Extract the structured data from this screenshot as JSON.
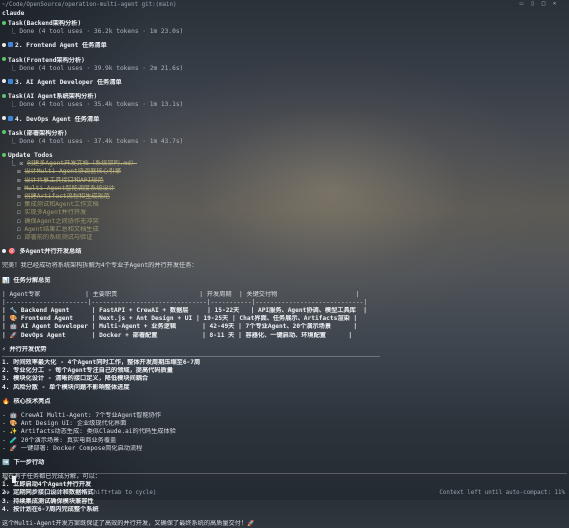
{
  "window": {
    "path": "~/Code/OpenSource/operation-multi-agent git:(main)",
    "app_title": "claude"
  },
  "tasks": [
    {
      "title": "Task(Backend架构分析)",
      "result": "Done (4 tool uses · 36.2k tokens · 1m 23.0s)"
    },
    {
      "heading": "2. Frontend Agent 任务清单"
    },
    {
      "title": "Task(Frontend架构分析)",
      "result": "Done (4 tool uses · 39.9k tokens · 2m 21.6s)"
    },
    {
      "heading": "3. AI Agent Developer 任务清单"
    },
    {
      "title": "Task(AI Agent系统架构分析)",
      "result": "Done (4 tool uses · 35.4k tokens · 1m 13.1s)"
    },
    {
      "heading": "4. DevOps Agent 任务清单"
    },
    {
      "title": "Task(部署架构分析)",
      "result": "Done (4 tool uses · 37.4k tokens · 1m 43.7s)"
    }
  ],
  "todos": {
    "title": "Update Todos",
    "items": [
      "创建多Agent开发文档（系统架构.md）",
      "设计Multi-Agent协调器核心引擎",
      "设计共享工具接口和API规范",
      "Multi-Agent智能调度系统设计",
      "创建Artifact流程和生成规范",
      "集成测试和Agent工作文档",
      "实现多Agent并行开发",
      "确保Agent之间协作无冲突",
      "Agent结果汇总和文档生成",
      "部署前的系统测试与验证"
    ]
  },
  "summary": {
    "heading": "多Agent并行开发总结",
    "intro": "完美！我已经成功将系统架构拆解为4个专业子Agent的并行开发任务：",
    "table_heading": "任务分解总览",
    "table_header": "| Agent专家            | 主要职责                      | 开发周期  | 关键交付物                     |",
    "table_sep": "|----------------------|-------------------------------|-----------|-----------------------------|",
    "rows": [
      "| 🔧 Backend Agent      | FastAPI + CrewAI + 数据层     | 15-22天   | API服务、Agent协调、模型工具库  |",
      "| 🎨 Frontend Agent     | Next.js + Ant Design + UI | 19-25天 | Chat界面、任务展示、Artifacts渲染 |",
      "| 🤖 AI Agent Developer | Multi-Agent + 业务逻辑       | 42-49天 | 7个专业Agent、20个演示场景      |",
      "| 🚀 DevOps Agent       | Docker + 部署配置            | 8-11 天 | 容器化、一键启动、环境配置      |"
    ],
    "adv_heading": "并行开发优势",
    "advantages": [
      "1. 时间效率最大化 - 4个Agent同时工作，整体开发周期压缩至6-7周",
      "2. 专业化分工 - 每个Agent专注自己的领域，提高代码质量",
      "3. 模块化设计 - 清晰的接口定义，降低模块间耦合",
      "4. 风险分散 - 单个模块问题不影响整体进度"
    ],
    "tech_heading": "核心技术亮点",
    "tech": [
      "- 🤖 CrewAI Multi-Agent: 7个专业Agent智能协作",
      "- 🎨 Ant Design UI: 企业级现代化界面",
      "- ✨ Artifacts动态生成: 类似Claude.ai的代码生成体验",
      "- 🧪 20个演示场景: 真实电商业务覆盖",
      "- 🚀 一键部署: Docker Compose简化启动流程"
    ],
    "next_heading": "下一步行动",
    "next_intro": "现在有子任务都已完成分解，可以：",
    "next": [
      "1. 立即启动4个Agent并行开发",
      "2. 定期同步接口设计和数据格式",
      "3. 持续集成测试确保模块兼容性",
      "4. 按计划在6-7周内完成整个系统"
    ],
    "closing": "这个Multi-Agent开发方案既保证了高效的并行开发，又确保了最终系统的高质量交付！🚀"
  },
  "prompt": {
    "caret": ">"
  },
  "status": {
    "left": "⏵⏵ auto-accept edits on (shift+tab to cycle)",
    "right": "Context left until auto-compact: 11%"
  }
}
